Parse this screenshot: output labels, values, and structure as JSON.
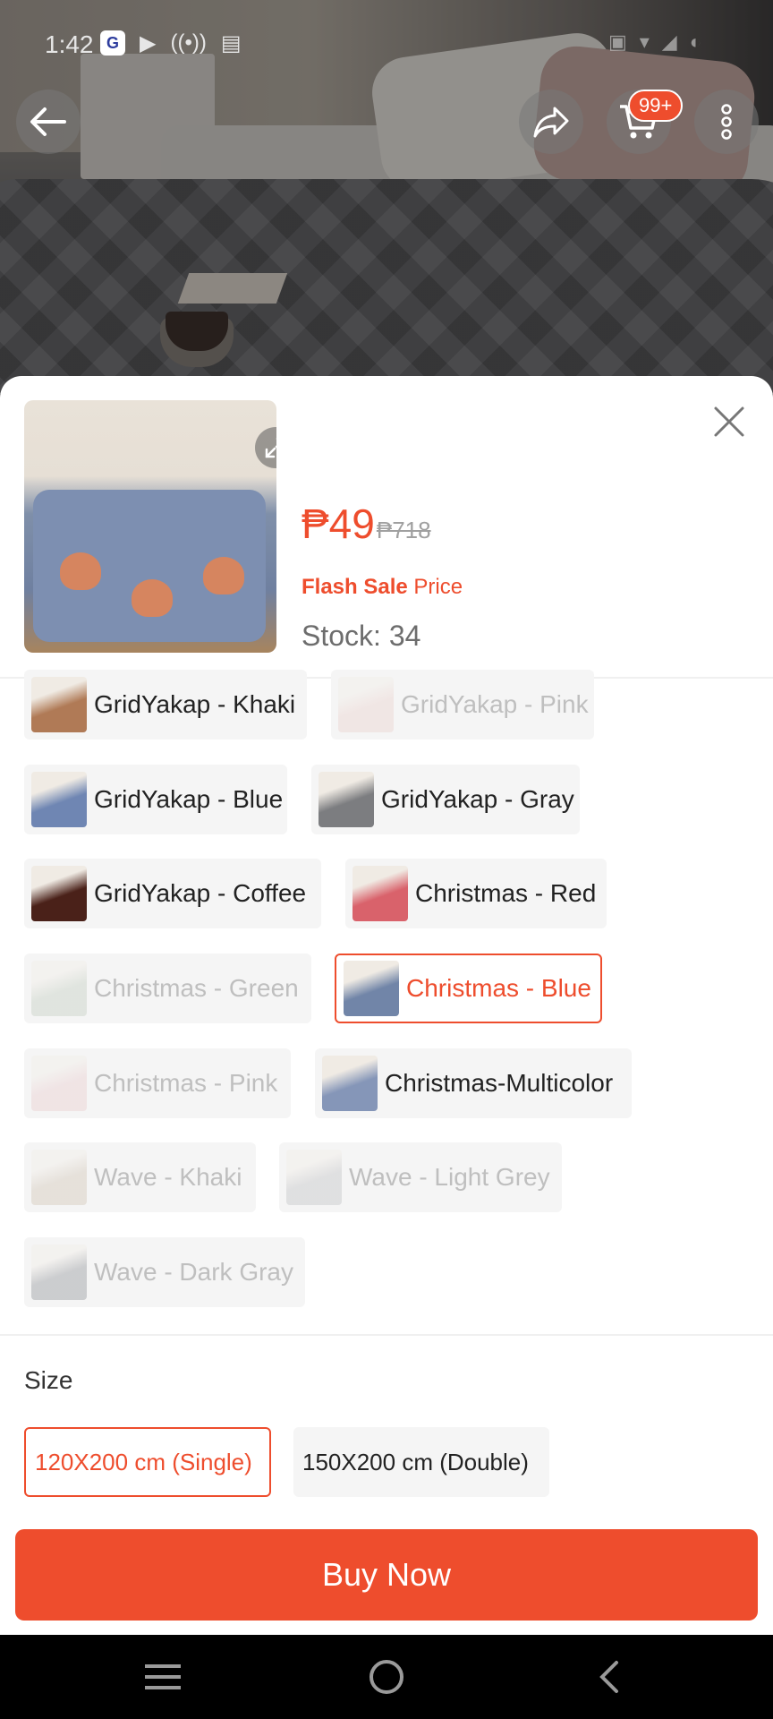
{
  "status_bar": {
    "time": "1:42",
    "app_icon": "G",
    "left_icons": [
      "▶",
      "((•))",
      "▤"
    ],
    "right_icons": [
      "▣",
      "▾",
      "◢",
      "◐"
    ]
  },
  "top_bar": {
    "cart_badge": "99+"
  },
  "product": {
    "price": "₱49",
    "original_price": "₱718",
    "flash_sale_label": "Flash Sale",
    "price_label": "Price",
    "stock": "Stock: 34"
  },
  "variations": [
    {
      "label": "GridYakap - Khaki",
      "state": "normal",
      "color": "#b07a56"
    },
    {
      "label": "GridYakap - Pink",
      "state": "disabled",
      "color": "#e8c9c4"
    },
    {
      "label": "GridYakap - Blue",
      "state": "normal",
      "color": "#6f86b3"
    },
    {
      "label": "GridYakap - Gray",
      "state": "normal",
      "color": "#7c7d80"
    },
    {
      "label": "GridYakap - Coffee",
      "state": "normal",
      "color": "#4a2119"
    },
    {
      "label": "Christmas - Red",
      "state": "normal",
      "color": "#d9626b"
    },
    {
      "label": "Christmas - Green",
      "state": "disabled",
      "color": "#b9c6b6"
    },
    {
      "label": "Christmas - Blue",
      "state": "selected",
      "color": "#7185a8"
    },
    {
      "label": "Christmas - Pink",
      "state": "disabled",
      "color": "#e7c3c6"
    },
    {
      "label": "Christmas-Multicolor",
      "state": "normal",
      "color": "#8596b8"
    },
    {
      "label": "Wave - Khaki",
      "state": "disabled",
      "color": "#c9bba9"
    },
    {
      "label": "Wave - Light Grey",
      "state": "disabled",
      "color": "#b7b8bb"
    },
    {
      "label": "Wave - Dark Gray",
      "state": "disabled",
      "color": "#7e8288"
    }
  ],
  "size": {
    "title": "Size",
    "options": [
      {
        "label": "120X200 cm (Single)",
        "state": "selected"
      },
      {
        "label": "150X200 cm (Double)",
        "state": "normal"
      }
    ]
  },
  "buy_button": "Buy Now",
  "colors": {
    "accent": "#ee4d2d",
    "disabled_text": "#bfbfbf"
  }
}
